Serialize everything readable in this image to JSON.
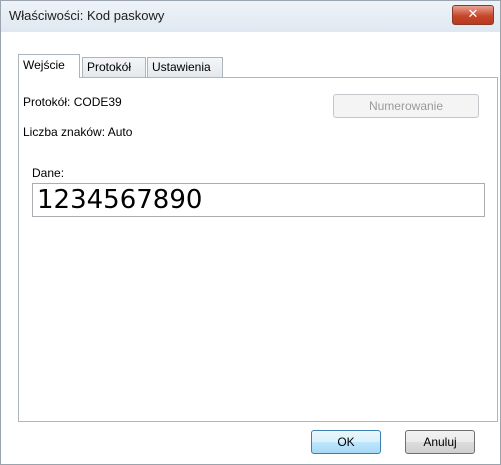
{
  "window": {
    "title": "Właściwości: Kod paskowy",
    "close_glyph": "✕",
    "accent_close": "#c7472b"
  },
  "tabs": [
    {
      "label": "Wejście",
      "active": true
    },
    {
      "label": "Protokół",
      "active": false
    },
    {
      "label": "Ustawienia",
      "active": false
    }
  ],
  "panel": {
    "protocol_label": "Protokół: CODE39",
    "char_count_label": "Liczba znaków: Auto",
    "numbering_button": "Numerowanie",
    "data_label": "Dane:",
    "data_value": "1234567890"
  },
  "footer": {
    "ok_label": "OK",
    "cancel_label": "Anuluj"
  }
}
